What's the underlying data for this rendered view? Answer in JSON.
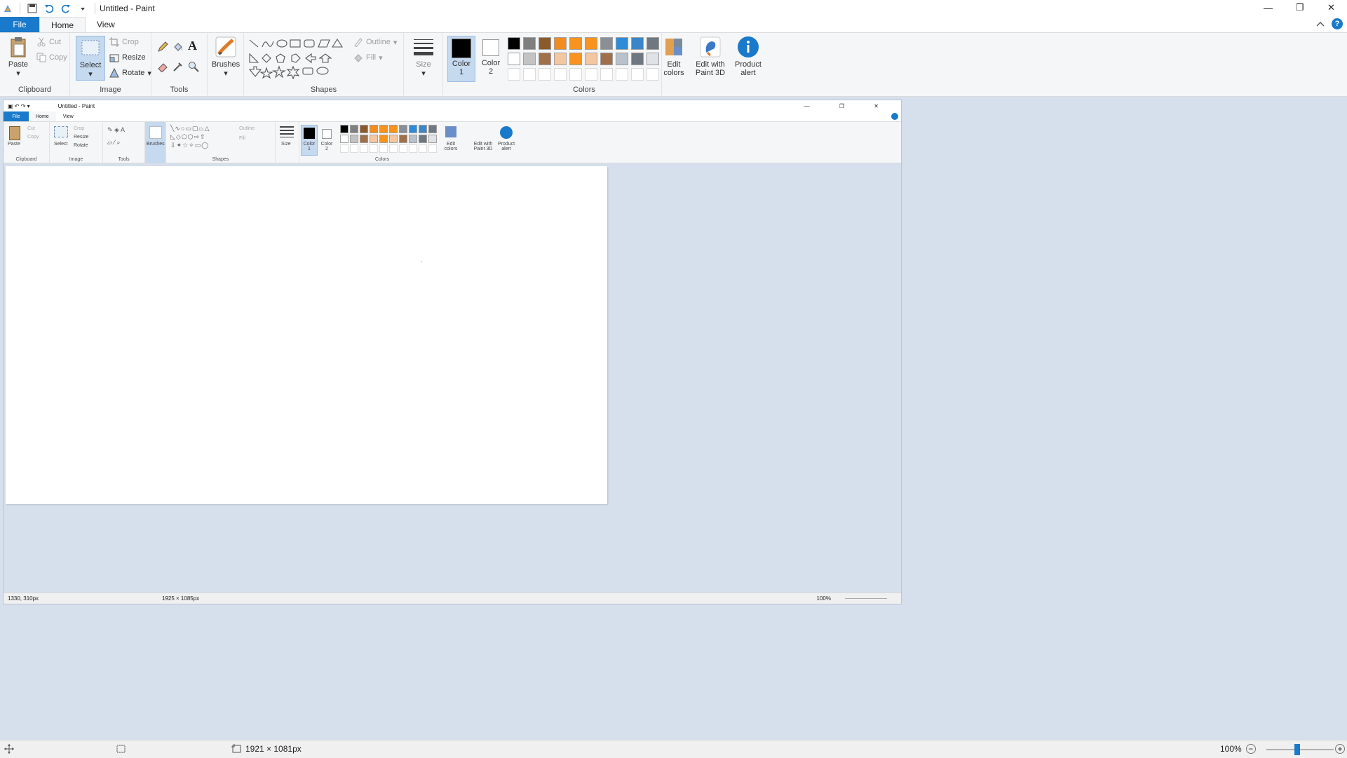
{
  "window": {
    "title": "Untitled - Paint",
    "controls": {
      "minimize": "—",
      "restore": "❐",
      "close": "✕"
    }
  },
  "tabs": {
    "file": "File",
    "home": "Home",
    "view": "View"
  },
  "ribbon": {
    "clipboard": {
      "label": "Clipboard",
      "paste": "Paste",
      "cut": "Cut",
      "copy": "Copy"
    },
    "image": {
      "label": "Image",
      "select": "Select",
      "crop": "Crop",
      "resize": "Resize",
      "rotate": "Rotate"
    },
    "tools": {
      "label": "Tools"
    },
    "brushes": {
      "label": "Brushes"
    },
    "shapes": {
      "label": "Shapes",
      "outline": "Outline",
      "fill": "Fill"
    },
    "size": {
      "label": "Size"
    },
    "color1": {
      "label_line1": "Color",
      "label_line2": "1",
      "value": "#000000"
    },
    "color2": {
      "label_line1": "Color",
      "label_line2": "2",
      "value": "#ffffff"
    },
    "colors": {
      "label": "Colors",
      "palette_row1": [
        "#000000",
        "#7f7f7f",
        "#8a5a2b",
        "#f28c1e",
        "#f7931e",
        "#f7931e",
        "#8a8f96",
        "#2e8bd8",
        "#3a86c8",
        "#6f7780"
      ],
      "palette_row2": [
        "#ffffff",
        "#c3c3c3",
        "#a0704a",
        "#f5c7a0",
        "#f7931e",
        "#f5c7a0",
        "#a0704a",
        "#b9c2cc",
        "#6f7780",
        "#dfe3e8"
      ]
    },
    "edit_colors": {
      "line1": "Edit",
      "line2": "colors"
    },
    "paint3d": {
      "line1": "Edit with",
      "line2": "Paint 3D"
    },
    "product_alert": {
      "line1": "Product",
      "line2": "alert"
    }
  },
  "nested": {
    "title": "Untitled - Paint",
    "tabs": {
      "file": "File",
      "home": "Home",
      "view": "View"
    },
    "groups": {
      "clipboard": "Clipboard",
      "image": "Image",
      "tools": "Tools",
      "shapes": "Shapes",
      "colors": "Colors"
    },
    "labels": {
      "paste": "Paste",
      "select": "Select",
      "brushes": "Brushes",
      "size": "Size",
      "color1": "Color 1",
      "color2": "Color 2",
      "edit_colors": "Edit colors",
      "paint3d": "Edit with Paint 3D",
      "product_alert": "Product alert",
      "crop": "Crop",
      "resize": "Resize",
      "rotate": "Rotate",
      "cut": "Cut",
      "copy": "Copy",
      "outline": "Outline",
      "fill": "Fill"
    },
    "status": {
      "cursor": "1330, 310px",
      "size": "1925 × 1085px",
      "zoom": "100%"
    }
  },
  "status": {
    "size": "1921 × 1081px",
    "zoom": "100%"
  }
}
